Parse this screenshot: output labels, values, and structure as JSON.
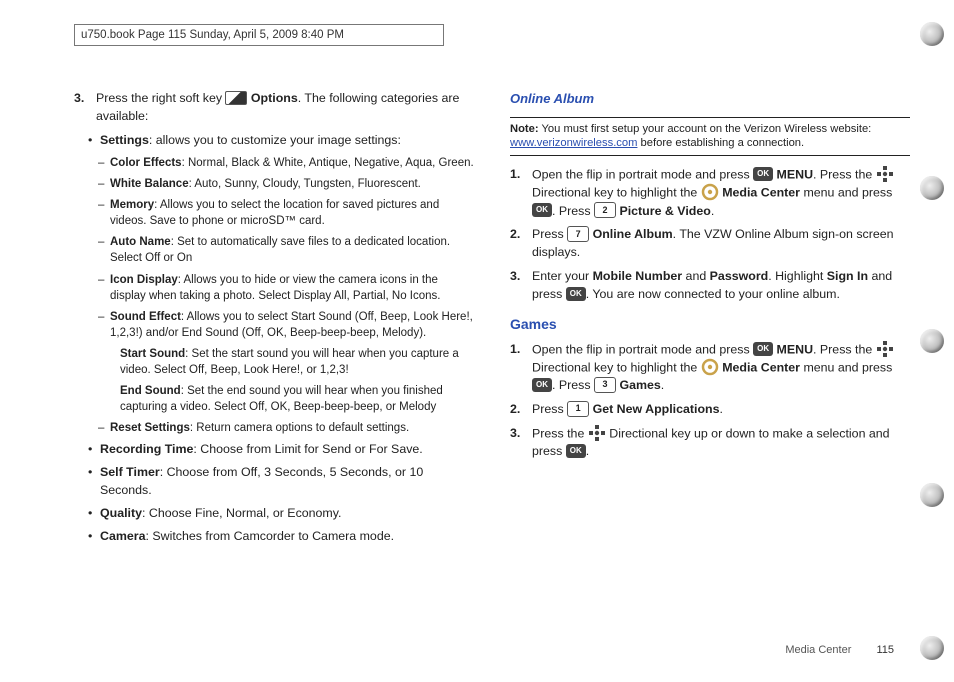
{
  "header": {
    "text": "u750.book  Page 115  Sunday, April 5, 2009  8:40 PM"
  },
  "left": {
    "step3_a": "Press the right soft key ",
    "step3_b": "Options",
    "step3_c": ". The following categories are available:",
    "settings_lead": "Settings",
    "settings_desc": ": allows you to customize your image settings:",
    "color": {
      "h": "Color Effects",
      "d": ": Normal, Black & White, Antique, Negative, Aqua, Green."
    },
    "wb": {
      "h": "White Balance",
      "d": ": Auto, Sunny, Cloudy, Tungsten, Fluorescent."
    },
    "mem": {
      "h": "Memory",
      "d": ": Allows you to select the location for saved pictures and videos. Save to phone or microSD™ card."
    },
    "auto": {
      "h": "Auto Name",
      "d": ": Set to automatically save files to a dedicated location. Select Off or On"
    },
    "icon": {
      "h": "Icon Display",
      "d": ": Allows you to hide or view the camera icons in the display when taking a photo. Select Display All, Partial, No Icons."
    },
    "sound": {
      "h": "Sound Effect",
      "d": ": Allows you to select Start Sound (Off, Beep, Look Here!, 1,2,3!) and/or End Sound (Off, OK, Beep-beep-beep, Melody)."
    },
    "start_sound": {
      "h": "Start Sound",
      "d": ": Set the start sound you will hear when you capture a video. Select Off, Beep, Look Here!, or 1,2,3!"
    },
    "end_sound": {
      "h": "End Sound",
      "d": ": Set the end sound you will hear when you finished capturing a video. Select Off, OK, Beep-beep-beep, or Melody"
    },
    "reset": {
      "h": "Reset Settings",
      "d": ": Return camera options to default settings."
    },
    "rectime": {
      "h": "Recording Time",
      "d": ": Choose from Limit for Send or For Save."
    },
    "selftimer": {
      "h": "Self Timer",
      "d": ": Choose from  Off, 3 Seconds, 5 Seconds, or 10 Seconds."
    },
    "quality": {
      "h": "Quality",
      "d": ": Choose Fine, Normal, or Economy."
    },
    "camera": {
      "h": "Camera",
      "d": ": Switches from Camcorder to Camera mode."
    }
  },
  "right": {
    "online_title": "Online Album",
    "note_lead": "Note:",
    "note_a": " You must first setup your account on the Verizon Wireless website: ",
    "note_link": "www.verizonwireless.com",
    "note_b": " before establishing a connection.",
    "oa1_a": "Open the flip in portrait mode and press ",
    "oa1_menu": "MENU",
    "oa1_b": ". Press the ",
    "oa1_c": " Directional key to highlight the ",
    "oa1_media": "Media Center",
    "oa1_d": " menu and press ",
    "oa1_e": ". Press ",
    "oa1_key2": "2",
    "oa1_pic": "Picture & Video",
    "oa1_f": ".",
    "oa2_a": "Press ",
    "oa2_key7": "7",
    "oa2_oa": "Online Album",
    "oa2_b": ". The VZW Online Album sign-on screen displays.",
    "oa3_a": "Enter your ",
    "oa3_mn": "Mobile Number",
    "oa3_b": " and ",
    "oa3_pw": "Password",
    "oa3_c": ". Highlight ",
    "oa3_si": "Sign In",
    "oa3_d": " and press ",
    "oa3_e": ". You are now connected to your online album.",
    "games_title": "Games",
    "g1_a": "Open the flip in portrait mode and press ",
    "g1_menu": "MENU",
    "g1_b": ". Press the ",
    "g1_c": " Directional key to highlight the ",
    "g1_media": "Media Center",
    "g1_d": " menu and press ",
    "g1_e": ". Press ",
    "g1_key3": "3",
    "g1_games": "Games",
    "g1_f": ".",
    "g2_a": "Press ",
    "g2_key1": "1",
    "g2_gna": "Get New Applications",
    "g2_b": ".",
    "g3_a": "Press the ",
    "g3_b": " Directional key up or down to make a selection and press ",
    "g3_c": "."
  },
  "footer": {
    "section": "Media Center",
    "page": "115"
  },
  "ok_label": "OK"
}
